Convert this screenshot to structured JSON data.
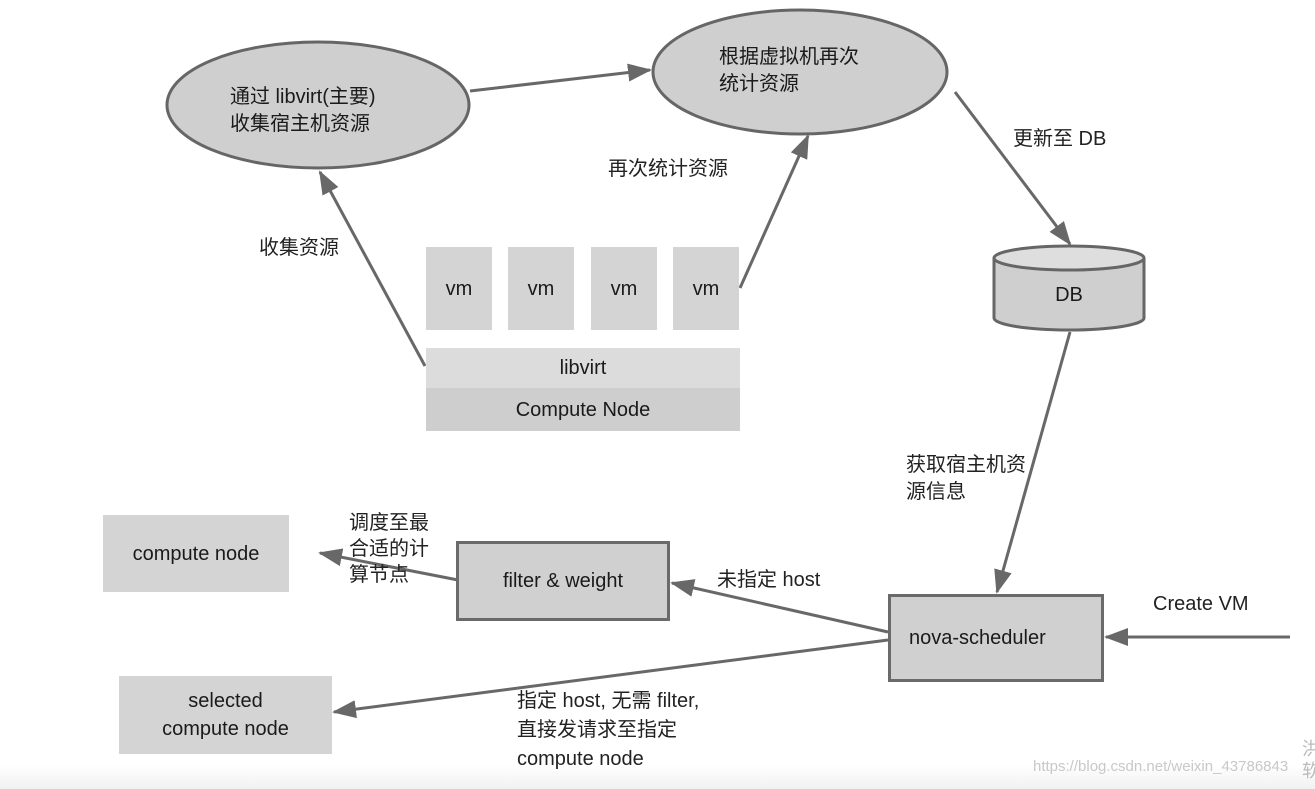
{
  "diagram": {
    "ellipses": {
      "collect": {
        "line1": "通过 libvirt(主要)",
        "line2": "收集宿主机资源"
      },
      "recount": {
        "line1": "根据虚拟机再次",
        "line2": "统计资源"
      }
    },
    "vms": [
      "vm",
      "vm",
      "vm",
      "vm"
    ],
    "libvirt_label": "libvirt",
    "compute_node_label": "Compute Node",
    "db_label": "DB",
    "nova_scheduler_label": "nova-scheduler",
    "filter_weight_label": "filter & weight",
    "compute_node_target_label": "compute node",
    "selected_node": {
      "line1": "selected",
      "line2": "compute node"
    },
    "edge_labels": {
      "collect_resources": "收集资源",
      "recount_resources": "再次统计资源",
      "update_db": "更新至 DB",
      "fetch_host_info": {
        "line1": "获取宿主机资",
        "line2": "源信息"
      },
      "create_vm": "Create VM",
      "no_host_specified": "未指定 host",
      "schedule_best": {
        "line1": "调度至最",
        "line2": "合适的计",
        "line3": "算节点"
      },
      "host_specified": {
        "line1": "指定 host, 无需 filter,",
        "line2": "直接发请求至指定",
        "line3": "compute node"
      }
    },
    "colors": {
      "node_fill": "#d4d4d4",
      "ellipse_fill": "#cfcfcf",
      "stroke": "#666666",
      "arrow": "#686868"
    }
  },
  "watermark": {
    "url": "https://blog.csdn.net/weixin_43786843",
    "side_glyphs": "洪\n软"
  }
}
